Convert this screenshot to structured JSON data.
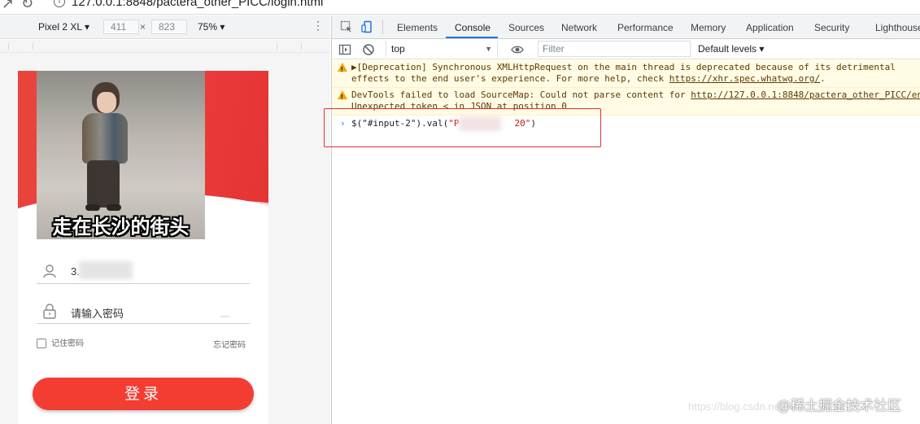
{
  "browser": {
    "url": "127.0.0.1:8848/pactera_other_PICC/login.html"
  },
  "device_toolbar": {
    "device": "Pixel 2 XL",
    "width": "411",
    "times": "×",
    "height": "823",
    "zoom": "75%",
    "more": "⋮"
  },
  "phone": {
    "photo_caption": "走在长沙的街头",
    "username_value": "3.",
    "password_placeholder": "请输入密码",
    "eye_glyph": "﹏",
    "remember_label": "记住密码",
    "forgot_label": "忘记密码",
    "login_button": "登录"
  },
  "devtools": {
    "tabs": [
      "Elements",
      "Console",
      "Sources",
      "Network",
      "Performance",
      "Memory",
      "Application",
      "Security",
      "Lighthouse"
    ],
    "active_tab": "Console",
    "context": "top",
    "filter_placeholder": "Filter",
    "levels": "Default levels",
    "messages": [
      {
        "type": "warning",
        "line1_prefix": "▶[Deprecation] Synchronous XMLHttpRequest on the main thread is deprecated because of its detrimental",
        "line2_prefix": "effects to the end user's experience. For more help, check ",
        "line2_link": "https://xhr.spec.whatwg.org/",
        "line2_suffix": "."
      },
      {
        "type": "warning",
        "line1_prefix": "DevTools failed to load SourceMap: Could not parse content for ",
        "line1_link": "http://127.0.0.1:8848/pactera_other_PICC/en",
        "line2": "Unexpected token < in JSON at position 0"
      }
    ],
    "prompt": {
      "chevron": "›",
      "cmd_prefix": "$(\"#input-2\").val(",
      "str_start": "\"P",
      "str_end": "20\"",
      "cmd_suffix": ")"
    }
  },
  "watermark": {
    "text": "@稀土掘金技术社区",
    "url": "https://blog.csdn.net/weixin_41937552"
  },
  "colors": {
    "accent": "#1a73e8",
    "brand_red": "#f43d32",
    "warning_bg": "#fffbe5",
    "highlight_box": "#e03131"
  }
}
